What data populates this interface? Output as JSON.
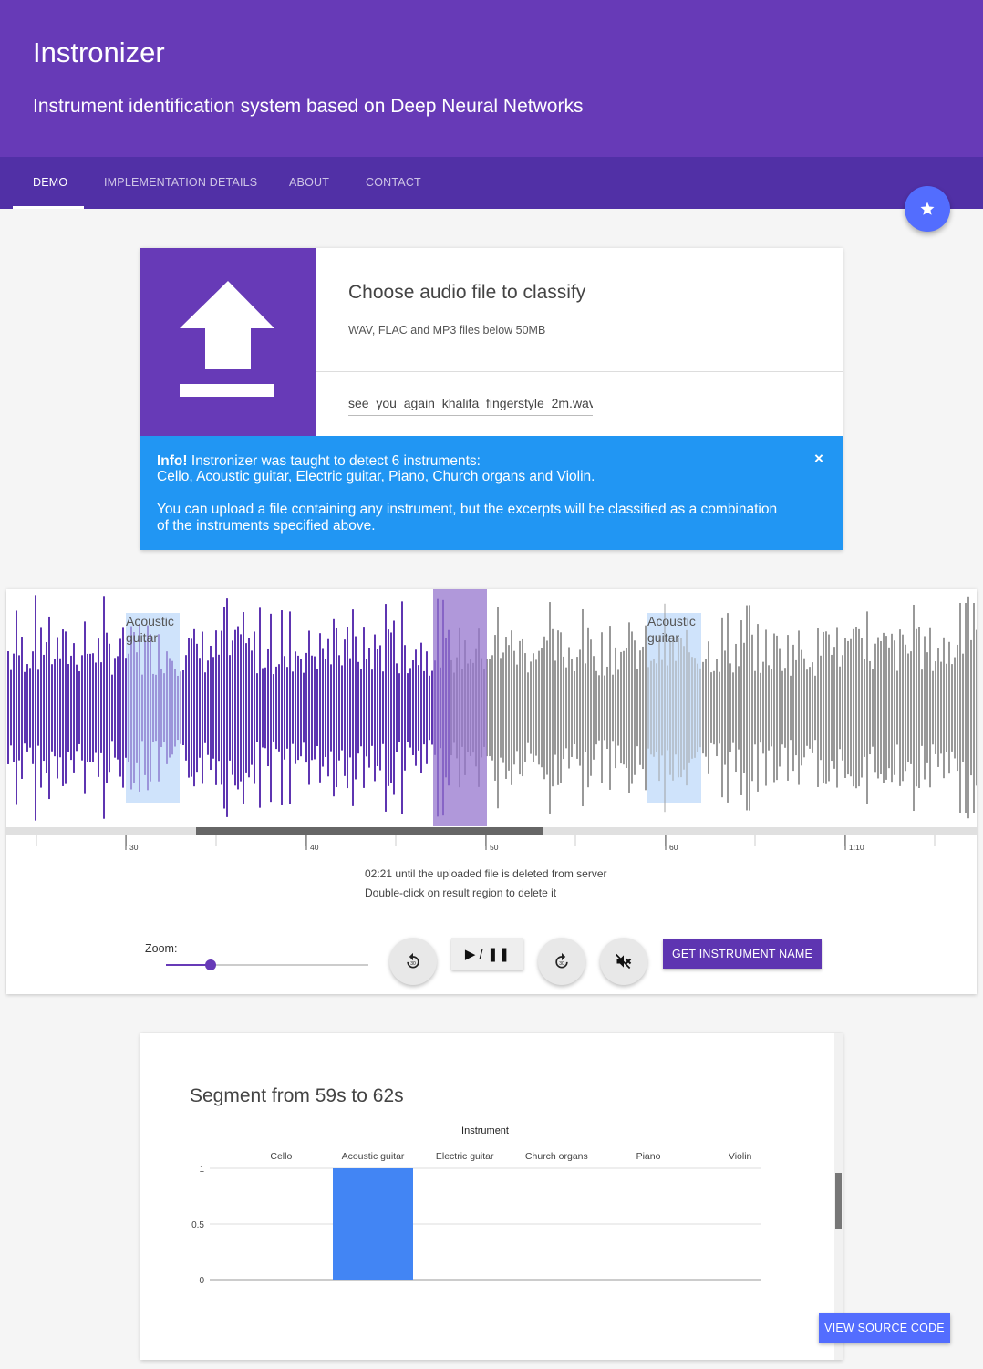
{
  "header": {
    "title": "Instronizer",
    "subtitle": "Instrument identification system based on Deep Neural Networks"
  },
  "tabs": [
    {
      "label": "DEMO",
      "active": true
    },
    {
      "label": "IMPLEMENTATION DETAILS",
      "active": false
    },
    {
      "label": "ABOUT",
      "active": false
    },
    {
      "label": "CONTACT",
      "active": false
    }
  ],
  "fab": {
    "icon": "star-icon"
  },
  "upload": {
    "icon": "upload-icon",
    "title": "Choose audio file to classify",
    "hint": "WAV, FLAC and MP3 files below 50MB",
    "file_value": "see_you_again_khalifa_fingerstyle_2m.wav"
  },
  "info": {
    "strong": "Info!",
    "line1": " Instronizer was taught to detect 6 instruments:",
    "line2": "Cello, Acoustic guitar, Electric guitar, Piano, Church organs and Violin.",
    "line3": "You can upload a file containing any instrument, but the excerpts will be classified as a combination",
    "line4": "of the instruments specified above.",
    "close": "×"
  },
  "waveform": {
    "region_labels": [
      "Acoustic guitar",
      "Acoustic guitar"
    ],
    "timeline_labels": [
      "30",
      "40",
      "50",
      "60",
      "1:10"
    ],
    "colors": {
      "played": "#5e35b1",
      "unplayed": "#999999",
      "region": "#cfe3fb",
      "selection": "#9575cd"
    }
  },
  "status": {
    "deletion": "02:21 until the uploaded file is deleted from server",
    "hint": "Double-click on result region to delete it"
  },
  "controls": {
    "zoom_label": "Zoom:",
    "zoom_level": 0.22,
    "rewind_icon": "replay-30-icon",
    "play_label": "▶ / ❚❚",
    "forward_icon": "forward-30-icon",
    "mute_icon": "volume-off-icon",
    "get_label": "GET INSTRUMENT NAME"
  },
  "result": {
    "title": "Segment from 59s to 62s"
  },
  "chart_data": {
    "type": "bar",
    "title": "",
    "xlabel": "Instrument",
    "ylabel": "",
    "categories": [
      "Cello",
      "Acoustic guitar",
      "Electric guitar",
      "Church organs",
      "Piano",
      "Violin"
    ],
    "values": [
      0,
      1,
      0,
      0,
      0,
      0
    ],
    "ylim": [
      0,
      1
    ],
    "yticks": [
      "1",
      "0.5",
      "0"
    ],
    "x_axis_position": "top",
    "grid": true,
    "bar_color": "#4285f4"
  },
  "footer": {
    "source_label": "VIEW SOURCE CODE"
  }
}
